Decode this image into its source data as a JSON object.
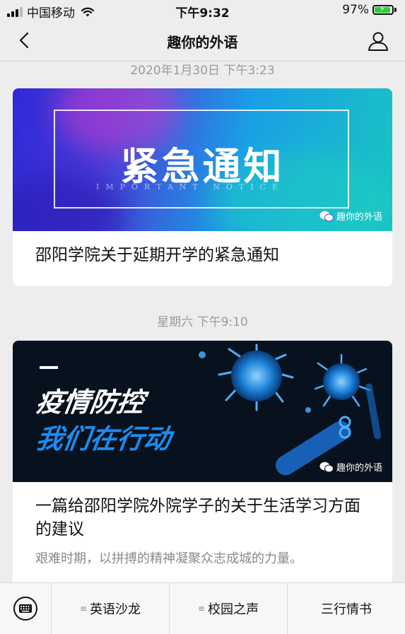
{
  "status_bar": {
    "carrier": "中国移动",
    "time": "下午9:32",
    "battery": "97%",
    "battery_level": 0.97
  },
  "nav": {
    "title": "趣你的外语",
    "back_icon": "chevron-left-icon",
    "profile_icon": "person-icon"
  },
  "messages": [
    {
      "timestamp": "2020年1月30日 下午3:23",
      "banner_text": "紧急通知",
      "banner_sub": "IMPORTANT NOTICE",
      "watermark": "趣你的外语",
      "title": "邵阳学院关于延期开学的紧急通知"
    },
    {
      "timestamp": "星期六 下午9:10",
      "banner_line1": "疫情防控",
      "banner_line2": "我们在行动",
      "watermark": "趣你的外语",
      "title": "一篇给邵阳学院外院学子的关于生活学习方面的建议",
      "description": "艰难时期，以拼搏的精神凝聚众志成城的力量。"
    }
  ],
  "bottom_menu": {
    "keyboard_icon": "keyboard-icon",
    "items": [
      {
        "label": "英语沙龙",
        "has_submenu": true
      },
      {
        "label": "校园之声",
        "has_submenu": true
      },
      {
        "label": "三行情书",
        "has_submenu": false
      }
    ]
  },
  "colors": {
    "background": "#ededed",
    "battery": "#2bcf3b",
    "accent_blue": "#1b8cf0"
  }
}
